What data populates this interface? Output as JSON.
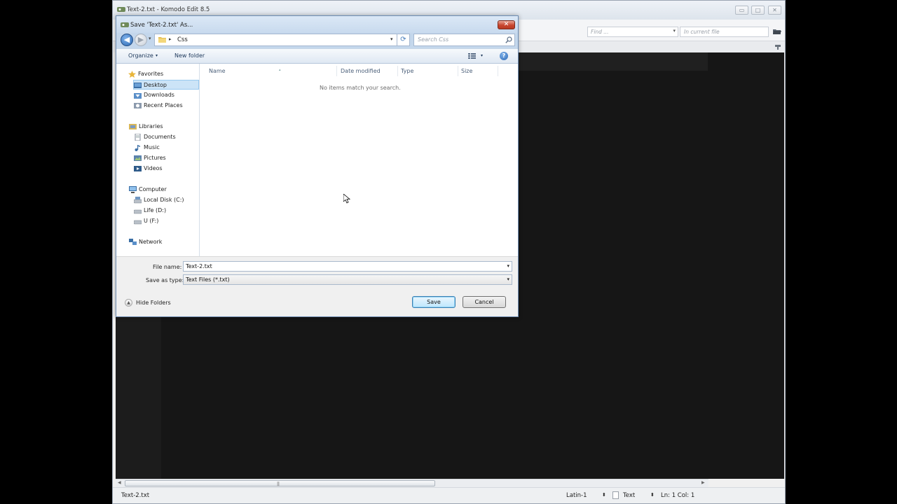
{
  "main_window": {
    "title": "Text-2.txt - Komodo Edit 8.5",
    "find_placeholder": "Find ...",
    "find_scope_placeholder": "In current file",
    "minimize_glyph": "▭",
    "maximize_glyph": "□",
    "close_glyph": "✕"
  },
  "statusbar": {
    "file": "Text-2.txt",
    "encoding": "Latin-1",
    "language": "Text",
    "position": "Ln: 1 Col: 1",
    "arrows": "⬍"
  },
  "dialog": {
    "title": "Save 'Text-2.txt' As...",
    "close_glyph": "✕",
    "back_glyph": "◀",
    "forward_glyph": "▶",
    "recent_glyph": "▾",
    "breadcrumb": [
      "Css"
    ],
    "breadcrumb_sep": "▸",
    "addr_drop_glyph": "▾",
    "refresh_glyph": "⟳",
    "search_placeholder": "Search Css",
    "organize_label": "Organize",
    "organize_arrow": "▾",
    "new_folder_label": "New folder",
    "views_arrow": "▾",
    "help_glyph": "?",
    "nav": [
      {
        "key": "favorites",
        "label": "Favorites",
        "icon": "star-icon"
      },
      {
        "key": "desktop",
        "label": "Desktop",
        "icon": "desktop-icon",
        "selected": true
      },
      {
        "key": "downloads",
        "label": "Downloads",
        "icon": "downloads-icon"
      },
      {
        "key": "recent-places",
        "label": "Recent Places",
        "icon": "recent-places-icon"
      },
      {
        "key": "libraries",
        "label": "Libraries",
        "icon": "libraries-icon"
      },
      {
        "key": "documents",
        "label": "Documents",
        "icon": "documents-icon"
      },
      {
        "key": "music",
        "label": "Music",
        "icon": "music-icon"
      },
      {
        "key": "pictures",
        "label": "Pictures",
        "icon": "pictures-icon"
      },
      {
        "key": "videos",
        "label": "Videos",
        "icon": "videos-icon"
      },
      {
        "key": "computer",
        "label": "Computer",
        "icon": "computer-icon"
      },
      {
        "key": "local-disk-c",
        "label": "Local Disk (C:)",
        "icon": "drive-icon"
      },
      {
        "key": "life-d",
        "label": "Life (D:)",
        "icon": "drive-icon"
      },
      {
        "key": "u-f",
        "label": "U (F:)",
        "icon": "drive-icon"
      },
      {
        "key": "network",
        "label": "Network",
        "icon": "network-icon"
      }
    ],
    "columns": [
      "Name",
      "Date modified",
      "Type",
      "Size"
    ],
    "sort_glyph": "▴",
    "empty_message": "No items match your search.",
    "file_name_label": "File name:",
    "file_name_value": "Text-2.txt",
    "save_type_label": "Save as type:",
    "save_type_value": "Text Files (*.txt)",
    "dropdown_glyph": "▾",
    "hide_folders_label": "Hide Folders",
    "hide_folders_glyph": "▲",
    "save_label": "Save",
    "cancel_label": "Cancel"
  },
  "colors": {
    "editor_bg": "#161616",
    "dialog_frame": "#c4d7ec",
    "selection": "#cce4f7",
    "close_red": "#c8452e"
  }
}
